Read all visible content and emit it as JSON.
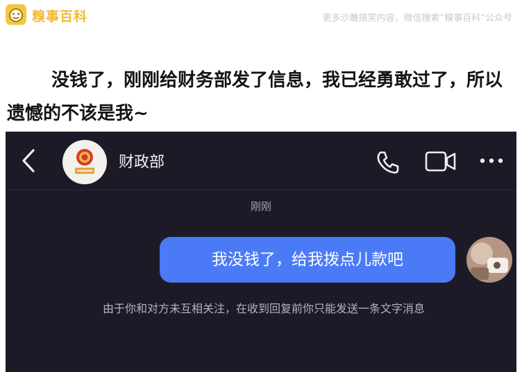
{
  "brand": {
    "logo_text": "糗事百科",
    "tagline": "更多沙雕搞笑内容，微信搜索“糗事百科”公众号"
  },
  "caption": "没钱了，刚刚给财务部发了信息，我已经勇敢过了，所以遗憾的不该是我~",
  "chat": {
    "contact_name": "财政部",
    "timestamp": "刚刚",
    "message": "我没钱了，给我拨点儿款吧",
    "notice": "由于你和对方未互相关注，在收到回复前你只能发送一条文字消息"
  },
  "icons": [
    "back-icon",
    "phone-call-icon",
    "video-call-icon",
    "more-icon"
  ],
  "colors": {
    "chat_background": "#1b1a26",
    "bubble": "#4a7af5",
    "brand": "#f2b935"
  }
}
